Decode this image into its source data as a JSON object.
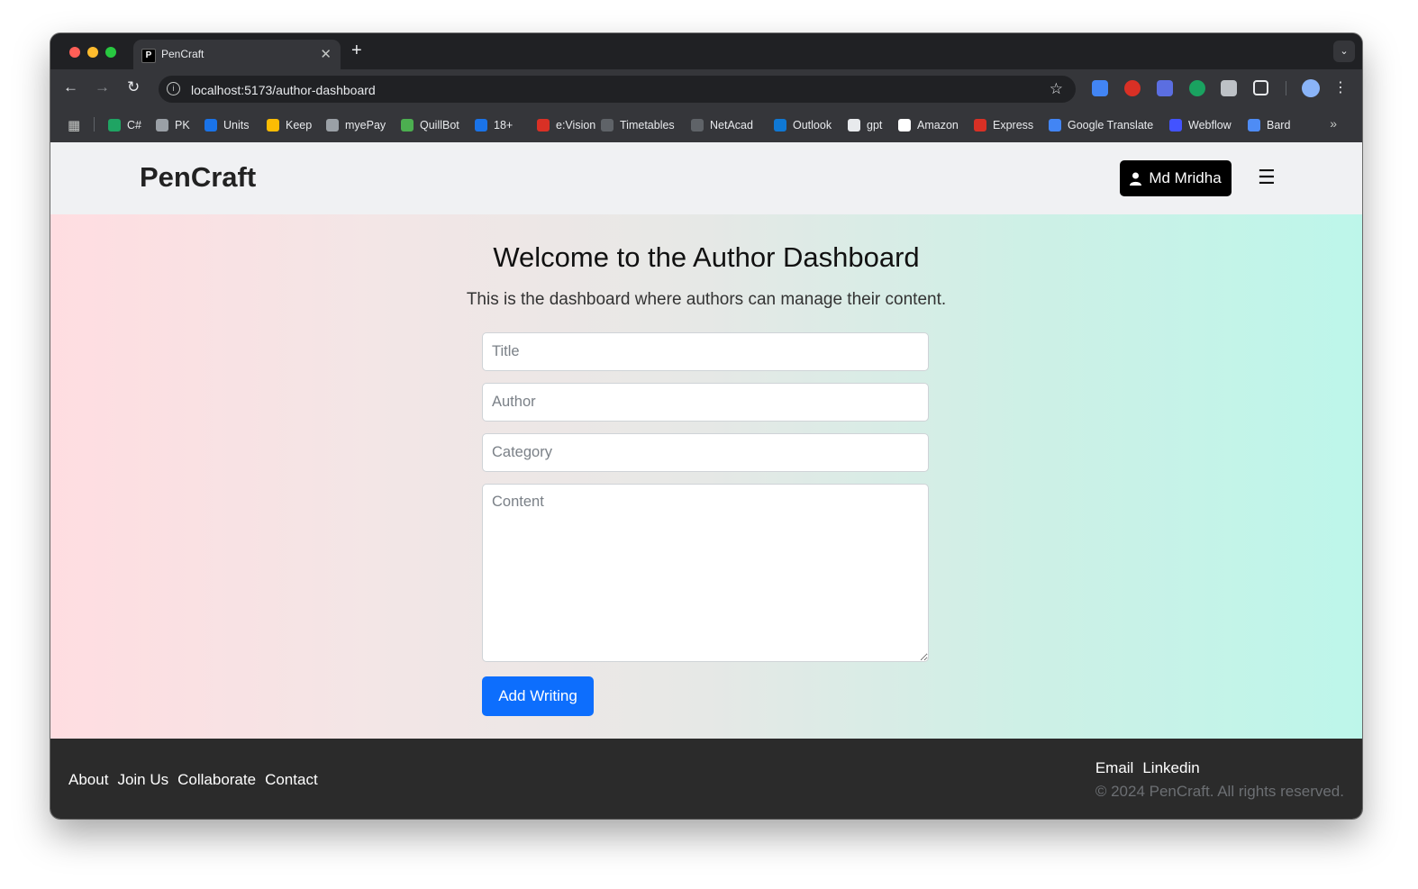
{
  "browser": {
    "tab_title": "PenCraft",
    "tab_favicon_letter": "P",
    "url": "localhost:5173/author-dashboard",
    "bookmarks": [
      {
        "label": "C#",
        "color": "#1fa463"
      },
      {
        "label": "PK",
        "color": "#9aa0a6"
      },
      {
        "label": "Units",
        "color": "#1a73e8"
      },
      {
        "label": "Keep",
        "color": "#fbbc04"
      },
      {
        "label": "myePay",
        "color": "#9aa0a6"
      },
      {
        "label": "QuillBot",
        "color": "#4caf50"
      },
      {
        "label": "18+",
        "color": "#1a73e8"
      },
      {
        "label": "e:Vision",
        "color": "#d93025"
      },
      {
        "label": "Timetables",
        "color": "#5f6368"
      },
      {
        "label": "NetAcad",
        "color": "#5f6368"
      },
      {
        "label": "Outlook",
        "color": "#0f78d4"
      },
      {
        "label": "gpt",
        "color": "#e8eaed"
      },
      {
        "label": "Amazon",
        "color": "#ffffff"
      },
      {
        "label": "Express",
        "color": "#d93025"
      },
      {
        "label": "Google Translate",
        "color": "#4285f4"
      },
      {
        "label": "Webflow",
        "color": "#4353ff"
      },
      {
        "label": "Bard",
        "color": "#4e8cf5"
      }
    ]
  },
  "site": {
    "brand": "PenCraft",
    "user_button_label": "Md Mridha",
    "menu_icon_glyph": "☰"
  },
  "main": {
    "heading": "Welcome to the Author Dashboard",
    "subheading": "This is the dashboard where authors can manage their content.",
    "form": {
      "title_placeholder": "Title",
      "author_placeholder": "Author",
      "category_placeholder": "Category",
      "content_placeholder": "Content",
      "submit_label": "Add Writing"
    }
  },
  "footer": {
    "links": [
      "About",
      "Join Us",
      "Collaborate",
      "Contact"
    ],
    "social": [
      "Email",
      "Linkedin"
    ],
    "copyright": "© 2024 PenCraft. All rights reserved."
  },
  "colors": {
    "primary_button": "#0d6efd",
    "user_button": "#000000",
    "footer_bg": "#2b2b2b",
    "hero_gradient_start": "#ffdde1",
    "hero_gradient_end": "#bdf6ea"
  }
}
